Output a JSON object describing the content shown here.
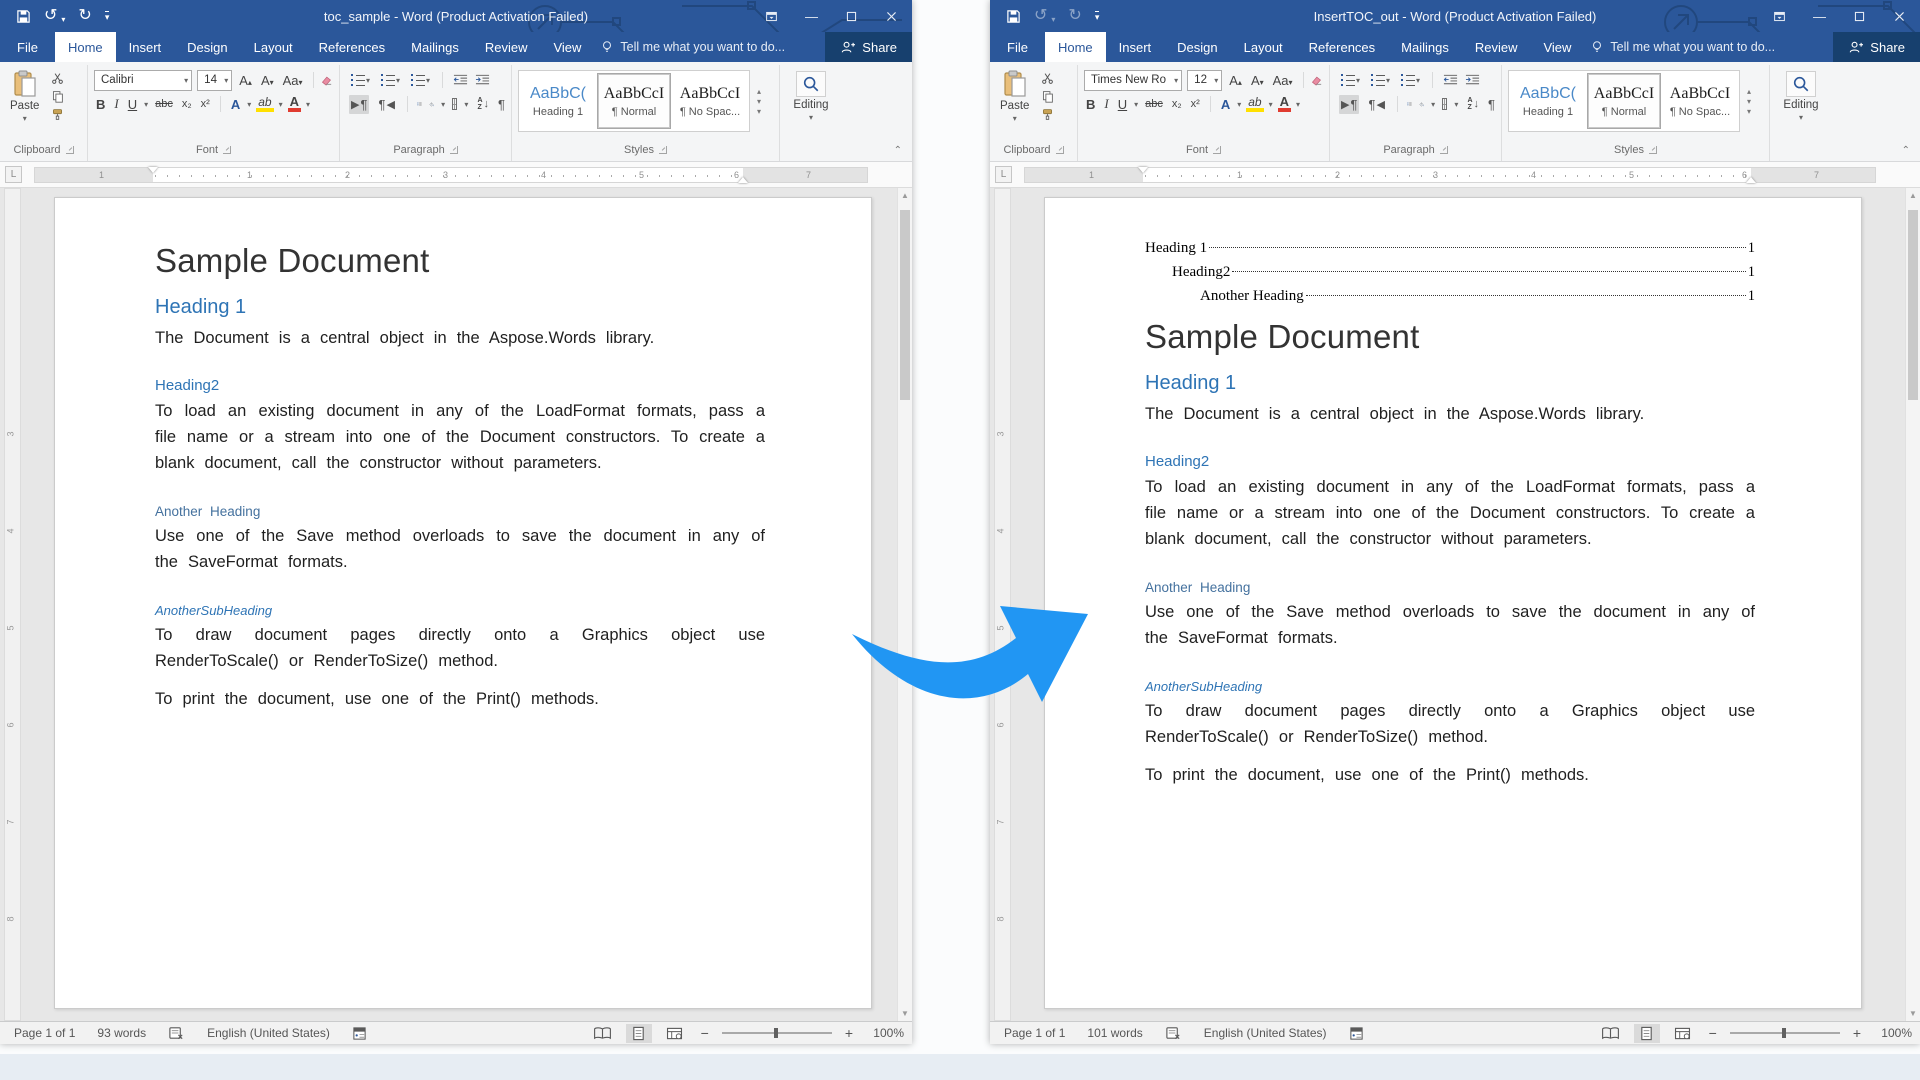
{
  "colors": {
    "titlebar_blue": "#2b579a",
    "share_bg": "#17406e",
    "heading_blue": "#2e74b5",
    "subheading_blue": "#44719e",
    "style_sample_blue": "#4a89c8",
    "arrow_blue": "#2196f3",
    "highlight_yellow": "#ffe000",
    "font_color_red": "#e03c31"
  },
  "left": {
    "title": "toc_sample - Word (Product Activation Failed)",
    "file_tab": "File",
    "tabs": [
      "Home",
      "Insert",
      "Design",
      "Layout",
      "References",
      "Mailings",
      "Review",
      "View"
    ],
    "tell_me": "Tell me what you want to do...",
    "share_label": "Share",
    "ribbon": {
      "paste_label": "Paste",
      "font_name": "Calibri",
      "font_size": "14",
      "groups": [
        "Clipboard",
        "Font",
        "Paragraph",
        "Styles"
      ],
      "styles": [
        {
          "sample": "AaBbC(",
          "name": "Heading 1"
        },
        {
          "sample": "AaBbCcI",
          "name": "¶ Normal"
        },
        {
          "sample": "AaBbCcI",
          "name": "¶ No Spac..."
        }
      ],
      "editing_label": "Editing"
    },
    "ruler": {
      "n0": "1",
      "n1": "1",
      "n2": "2",
      "n3": "3",
      "n4": "4",
      "n5": "5",
      "n6": "6",
      "n7": "7",
      "v3": "3",
      "v4": "4",
      "v5": "5",
      "v6": "6",
      "v7": "7",
      "v8": "8"
    },
    "toc": [],
    "doc": {
      "title": "Sample Document",
      "h1": "Heading 1",
      "p1": "The Document is a central object in the Aspose.Words library.",
      "h2": "Heading2",
      "p2": "To load an existing document in any of the LoadFormat formats, pass a file name or a stream into one of the Document constructors. To create a blank document, call the constructor without parameters.",
      "h3": "Another Heading",
      "p3": "Use one of the Save method overloads to save the document in any of the SaveFormat formats.",
      "h4": "AnotherSubHeading",
      "p4": "To draw document pages directly onto a Graphics object use RenderToScale() or RenderToSize() method.",
      "p5": "To print the document, use one of the Print() methods."
    },
    "status": {
      "page": "Page 1 of 1",
      "words": "93 words",
      "language": "English (United States)",
      "zoom": "100%"
    }
  },
  "right": {
    "title": "InsertTOC_out - Word (Product Activation Failed)",
    "file_tab": "File",
    "tabs": [
      "Home",
      "Insert",
      "Design",
      "Layout",
      "References",
      "Mailings",
      "Review",
      "View"
    ],
    "tell_me": "Tell me what you want to do...",
    "share_label": "Share",
    "ribbon": {
      "paste_label": "Paste",
      "font_name": "Times New Ro",
      "font_size": "12",
      "groups": [
        "Clipboard",
        "Font",
        "Paragraph",
        "Styles"
      ],
      "styles": [
        {
          "sample": "AaBbC(",
          "name": "Heading 1"
        },
        {
          "sample": "AaBbCcI",
          "name": "¶ Normal"
        },
        {
          "sample": "AaBbCcI",
          "name": "¶ No Spac..."
        }
      ],
      "editing_label": "Editing"
    },
    "ruler": {
      "n0": "1",
      "n1": "1",
      "n2": "2",
      "n3": "3",
      "n4": "4",
      "n5": "5",
      "n6": "6",
      "n7": "7",
      "v3": "3",
      "v4": "4",
      "v5": "5",
      "v6": "6",
      "v7": "7",
      "v8": "8"
    },
    "toc": [
      {
        "text": "Heading 1",
        "page": "1"
      },
      {
        "text": "Heading2",
        "page": "1"
      },
      {
        "text": "Another Heading",
        "page": "1"
      }
    ],
    "doc": {
      "title": "Sample Document",
      "h1": "Heading 1",
      "p1": "The Document is a central object in the Aspose.Words library.",
      "h2": "Heading2",
      "p2": "To load an existing document in any of the LoadFormat formats, pass a file name or a stream into one of the Document constructors. To create a blank document, call the constructor without parameters.",
      "h3": "Another Heading",
      "p3": "Use one of the Save method overloads to save the document in any of the SaveFormat formats.",
      "h4": "AnotherSubHeading",
      "p4": "To draw document pages directly onto a Graphics object use RenderToScale() or RenderToSize() method.",
      "p5": "To print the document, use one of the Print() methods."
    },
    "status": {
      "page": "Page 1 of 1",
      "words": "101 words",
      "language": "English (United States)",
      "zoom": "100%"
    }
  }
}
